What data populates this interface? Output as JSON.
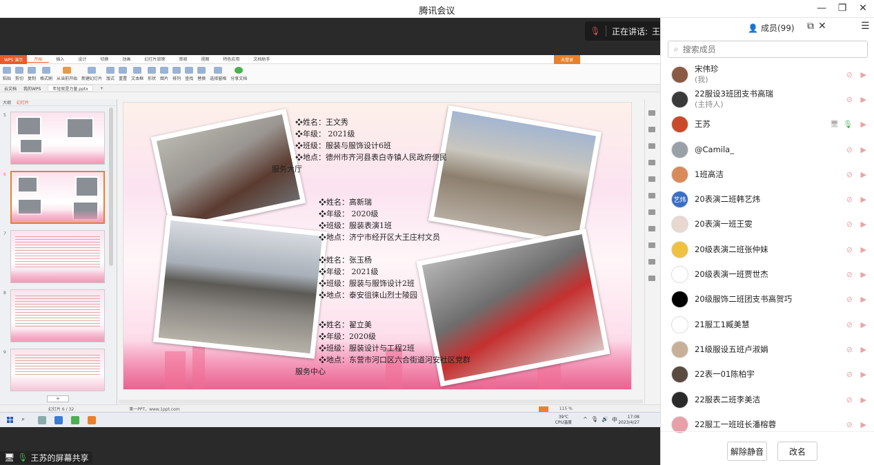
{
  "app": {
    "title": "腾讯会议"
  },
  "speaking": {
    "label": "正在讲话:",
    "name": "王苏;"
  },
  "wps": {
    "logo": "WPS 演示",
    "tabs": [
      "开始",
      "插入",
      "设计",
      "切换",
      "动画",
      "幻灯片放映",
      "审阅",
      "视图",
      "特色应用",
      "文档助手"
    ],
    "active_tab": "开始",
    "login": "未登录",
    "doc_tabs": [
      "云文档",
      "我的WPS",
      "年轻就是力量.pptx"
    ],
    "panel_tabs": [
      "大纲",
      "幻灯片"
    ],
    "ribbon": [
      "粘贴",
      "剪切",
      "复制",
      "格式刷",
      "从当前开始",
      "新建幻灯片",
      "版式",
      "重置",
      "文本框",
      "形状",
      "图片",
      "排列",
      "查找",
      "替换",
      "选择窗格",
      "分享文档"
    ],
    "slide_text": {
      "block1": [
        "❖姓名：王文秀",
        "❖年级： 2021级",
        "❖班级：服装与服饰设计6班",
        "❖地点：德州市齐河县表白寺镇人民政府便民",
        "服务大厅"
      ],
      "block2": [
        "❖姓名：高新瑞",
        "❖年级： 2020级",
        "❖班级：服装表演1班",
        "❖地点：济宁市经开区大王庄村文员"
      ],
      "block3": [
        "❖姓名：张玉杨",
        "❖年级： 2021级",
        "❖班级：服装与服饰设计2班",
        "❖地点：泰安徂徕山烈士陵园"
      ],
      "block4": [
        "❖姓名：翟立美",
        "❖年级：2020级",
        "❖班级：服装设计与工程2班",
        "❖地点：东营市河口区六合街道河安社区党群",
        "服务中心"
      ]
    },
    "status_left": "幻灯片 6 / 32",
    "status_theme": "第一PPT，www.1ppt.com",
    "zoom": "115 %",
    "slide_numbers": [
      "5",
      "6",
      "7",
      "8",
      "9"
    ]
  },
  "taskbar": {
    "temp": "39℃",
    "temp_label": "CPU温度",
    "time": "17:08",
    "date": "2023/4/27",
    "ime": "中"
  },
  "sharing_label": "王苏的屏幕共享",
  "members_panel": {
    "tab_label": "成员(99)",
    "search_placeholder": "搜索成员",
    "members": [
      {
        "name": "宋伟珍",
        "sub": "(我)",
        "color": "#8a5a44"
      },
      {
        "name": "22服设3班团支书高瑞",
        "sub": "(主持人)",
        "color": "#3a3a3a"
      },
      {
        "name": "王苏",
        "sub": "",
        "color": "#c84a2a"
      },
      {
        "name": "@Camila_",
        "sub": "",
        "color": "#9aa0a8"
      },
      {
        "name": "1班高洁",
        "sub": "",
        "color": "#d98a5a"
      },
      {
        "name": "20表演二班韩艺炜",
        "sub": "",
        "color": "#3a6fc4",
        "initials": "艺炜"
      },
      {
        "name": "20表演一班王雯",
        "sub": "",
        "color": "#e8d8d0"
      },
      {
        "name": "20级表演二班张仲妹",
        "sub": "",
        "color": "#f0c040"
      },
      {
        "name": "20级表演一班贾世杰",
        "sub": "",
        "color": "#ffffff"
      },
      {
        "name": "20级服饰二班团支书高贺巧",
        "sub": "",
        "color": "#000000"
      },
      {
        "name": "21服工1臧美慧",
        "sub": "",
        "color": "#ffffff"
      },
      {
        "name": "21级服设五班卢淑娟",
        "sub": "",
        "color": "#c8b098"
      },
      {
        "name": "22表一01陈柏宇",
        "sub": "",
        "color": "#5a4a40"
      },
      {
        "name": "22服表二班李美洁",
        "sub": "",
        "color": "#2a2a2a"
      },
      {
        "name": "22服工一班班长潘榕蓉",
        "sub": "",
        "color": "#e8a0a8"
      }
    ],
    "unmute_all": "解除静音",
    "rename": "改名"
  }
}
